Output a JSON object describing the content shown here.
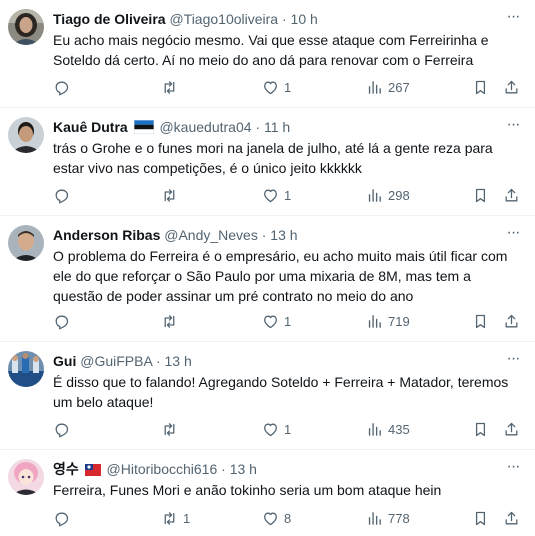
{
  "tweets": [
    {
      "name": "Tiago de Oliveira",
      "flag": "",
      "handle": "@Tiago10oliveira",
      "time": "10 h",
      "text": "Eu acho mais negócio mesmo. Vai que esse ataque com Ferreirinha e Soteldo dá certo. Aí no meio do ano dá para renovar com o Ferreira",
      "replies": "",
      "retweets": "",
      "likes": "1",
      "views": "267",
      "avatar_icon": "woman-avatar-icon"
    },
    {
      "name": "Kauê Dutra",
      "flag": "estonia-flag-icon",
      "handle": "@kauedutra04",
      "time": "11 h",
      "text": "trás o Grohe e o funes mori na janela de julho, até lá a gente reza para estar vivo nas competições, é o único jeito kkkkkk",
      "replies": "",
      "retweets": "",
      "likes": "1",
      "views": "298",
      "avatar_icon": "man-avatar-icon"
    },
    {
      "name": "Anderson Ribas",
      "flag": "",
      "handle": "@Andy_Neves",
      "time": "13 h",
      "text": "O problema do Ferreira é o empresário, eu acho muito mais útil ficar com ele do que reforçar o São Paulo por uma mixaria de 8M, mas tem a questão de poder assinar um pré contrato no meio do ano",
      "replies": "",
      "retweets": "",
      "likes": "1",
      "views": "719",
      "avatar_icon": "man-avatar-icon"
    },
    {
      "name": "Gui",
      "flag": "",
      "handle": "@GuiFPBA",
      "time": "13 h",
      "text": "É disso que to falando! Agregando Soteldo + Ferreira + Matador, teremos um belo ataque!",
      "replies": "",
      "retweets": "",
      "likes": "1",
      "views": "435",
      "avatar_icon": "team-avatar-icon"
    },
    {
      "name": "영수",
      "flag": "taiwan-flag-icon",
      "handle": "@Hitoribocchi616",
      "time": "13 h",
      "text": "Ferreira, Funes Mori e anão tokinho seria um bom ataque hein",
      "replies": "",
      "retweets": "1",
      "likes": "8",
      "views": "778",
      "avatar_icon": "anime-avatar-icon"
    }
  ],
  "separator": "·",
  "icons": {
    "reply": "reply-icon",
    "retweet": "retweet-icon",
    "like": "heart-icon",
    "views": "views-icon",
    "bookmark": "bookmark-icon",
    "share": "share-icon",
    "more": "more-icon"
  },
  "colors": {
    "text": "#0f1419",
    "secondary": "#536471",
    "divider": "#eff3f4"
  }
}
